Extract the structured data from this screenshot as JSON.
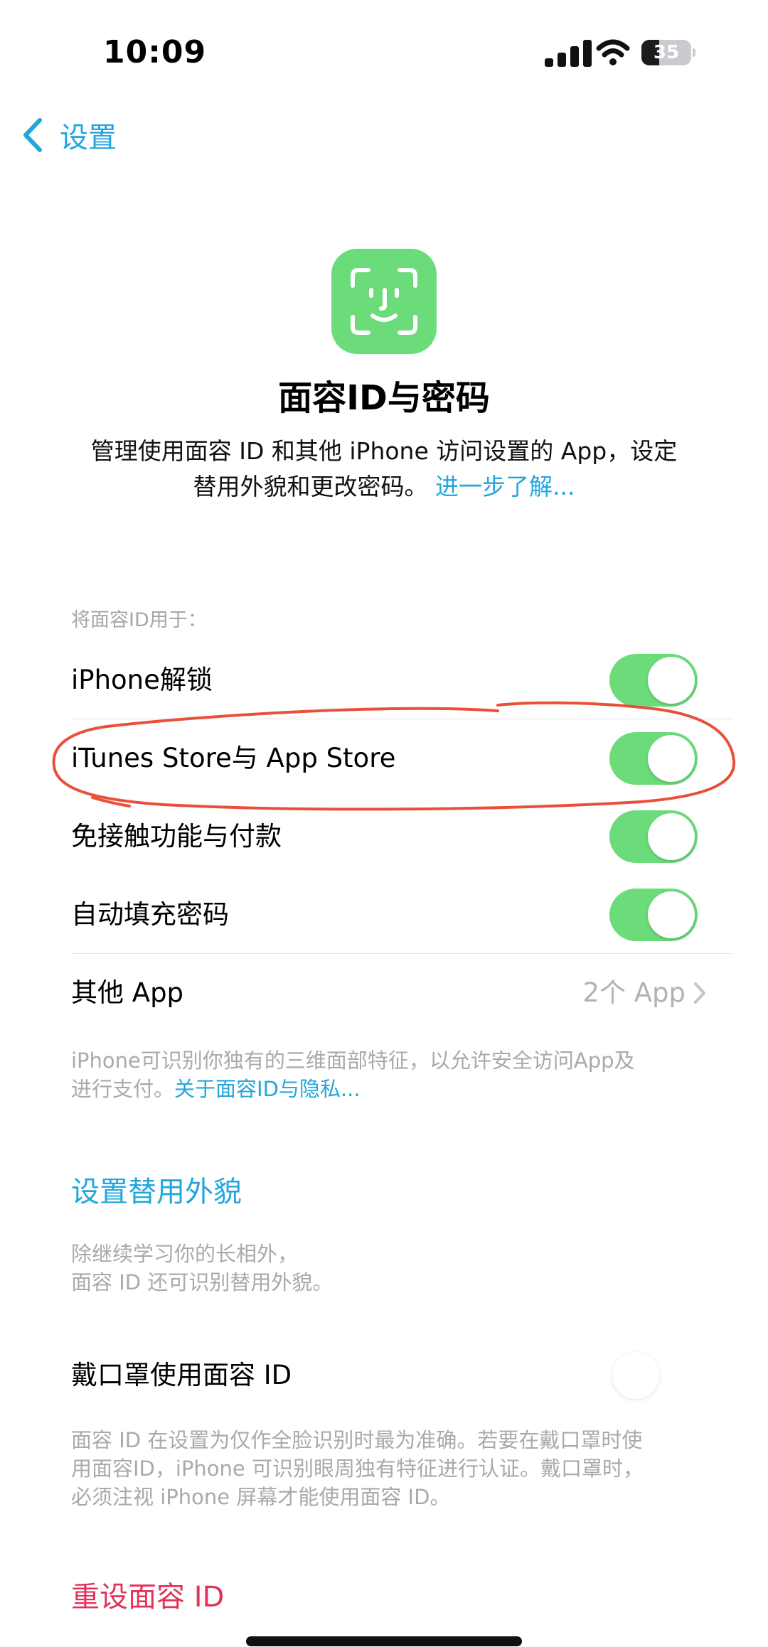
{
  "status_bar": {
    "time": "10:09",
    "battery_percent": "35",
    "battery_level": 0.35
  },
  "nav": {
    "back_label": "设置"
  },
  "header": {
    "title": "面容ID与密码",
    "desc_line1": "管理使用面容 ID 和其他 iPhone 访问设置的 App，设定",
    "desc_line2": "替用外貌和更改密码。",
    "learn_more": "进一步了解..."
  },
  "section": {
    "label": "将面容ID用于：",
    "rows": [
      {
        "label": "iPhone解锁",
        "on": true
      },
      {
        "label": "iTunes Store与 App Store",
        "on": true
      },
      {
        "label": "免接触功能与付款",
        "on": true
      },
      {
        "label": "自动填充密码",
        "on": true
      }
    ],
    "other_apps": {
      "label": "其他 App",
      "value": "2个 App"
    },
    "footnote_line1": "iPhone可识别你独有的三维面部特征，以允许安全访问App及",
    "footnote_line2_prefix": "进行支付。",
    "footnote_link": "关于面容ID与隐私..."
  },
  "alternate": {
    "action": "设置替用外貌",
    "footnote_line1": "除继续学习你的长相外，",
    "footnote_line2": "面容 ID 还可识别替用外貌。"
  },
  "mask": {
    "label": "戴口罩使用面容 ID",
    "on": false,
    "footnote_line1": "面容 ID 在设置为仅作全脸识别时最为准确。若要在戴口罩时使",
    "footnote_line2": "用面容ID，iPhone 可识别眼周独有特征进行认证。戴口罩时，",
    "footnote_line3": "必须注视 iPhone 屏幕才能使用面容 ID。"
  },
  "reset": {
    "action": "重设面容 ID"
  },
  "colors": {
    "accent": "#22a6dd",
    "toggle_on": "#6cdc7a",
    "destructive": "#e2325a",
    "annotation": "#e8503a"
  }
}
